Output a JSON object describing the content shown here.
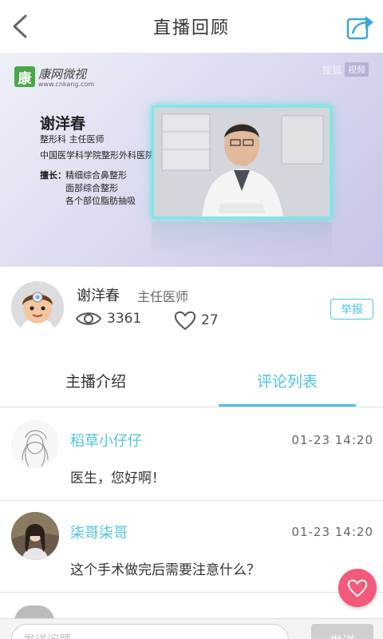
{
  "header": {
    "title": "直播回顾"
  },
  "video": {
    "logo_text": "康",
    "logo_name": "康网微视",
    "logo_url": "www.cnkang.com",
    "watermark_1": "搜狐",
    "watermark_2": "视频",
    "doctor_name": "谢洋春",
    "dept_title": "整形科 主任医师",
    "hospital": "中国医学科学院整形外科医院",
    "speciality_label": "擅长：",
    "speciality_items": [
      "精细综合鼻整形",
      "面部综合整形",
      "各个部位脂肪抽吸"
    ]
  },
  "doctor": {
    "name": "谢洋春",
    "title": "主任医师",
    "views": "3361",
    "likes": "27",
    "report_label": "举报"
  },
  "tabs": [
    {
      "label": "主播介绍",
      "active": false
    },
    {
      "label": "评论列表",
      "active": true
    }
  ],
  "comments": [
    {
      "user": "稻草小仔仔",
      "time": "01-23 14:20",
      "text": "医生，您好啊！"
    },
    {
      "user": "柒哥柒哥",
      "time": "01-23 14:20",
      "text": "这个手术做完后需要注意什么？"
    }
  ],
  "input": {
    "placeholder": "发送问题",
    "send_label": "发送"
  },
  "colors": {
    "accent": "#4dc3e0",
    "fab": "#f25a7a"
  },
  "icons": {
    "back": "chevron-left-icon",
    "share": "share-icon",
    "views": "eye-icon",
    "likes": "heart-outline-icon",
    "fab": "heart-icon"
  }
}
